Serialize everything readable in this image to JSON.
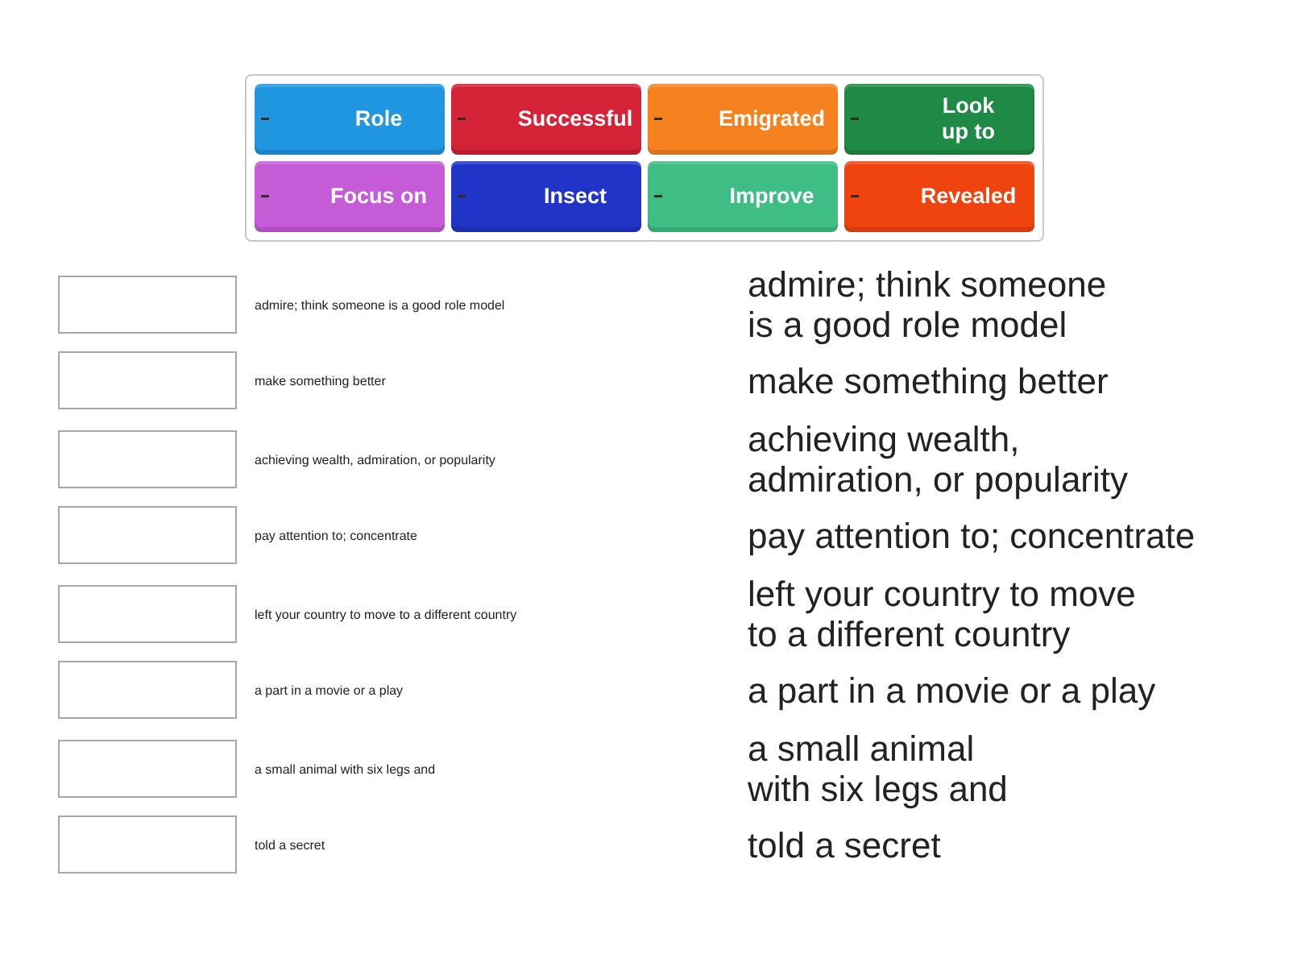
{
  "word_bank": {
    "tiles": [
      {
        "label": "Role",
        "color": "#2196e0"
      },
      {
        "label": "Successful",
        "color": "#d42236"
      },
      {
        "label": "Emigrated",
        "color": "#f5821e"
      },
      {
        "label": "Look up to",
        "color": "#1f8a45"
      },
      {
        "label": "Focus on",
        "color": "#c55bd6"
      },
      {
        "label": "Insect",
        "color": "#2035c8"
      },
      {
        "label": "Improve",
        "color": "#3ebd85"
      },
      {
        "label": "Revealed",
        "color": "#f0440f"
      }
    ]
  },
  "rows": [
    {
      "clue": "admire; think someone is a good role model",
      "definition_lines": [
        "admire; think someone",
        "is a good role model"
      ]
    },
    {
      "clue": "make something better",
      "definition_lines": [
        "make something better"
      ]
    },
    {
      "clue": "achieving wealth, admiration, or popularity",
      "definition_lines": [
        "achieving wealth,",
        "admiration, or popularity"
      ]
    },
    {
      "clue": "pay attention to; concentrate",
      "definition_lines": [
        "pay attention to; concentrate"
      ]
    },
    {
      "clue": "left your country to move to a different country",
      "definition_lines": [
        "left your country to move",
        "to a different country"
      ]
    },
    {
      "clue": "a part in a movie or a play",
      "definition_lines": [
        "a part in a movie or a play"
      ]
    },
    {
      "clue": "a small animal with six legs and",
      "definition_lines": [
        "a small animal",
        "with six legs and"
      ]
    },
    {
      "clue": "told a secret",
      "definition_lines": [
        "told a secret"
      ]
    }
  ]
}
